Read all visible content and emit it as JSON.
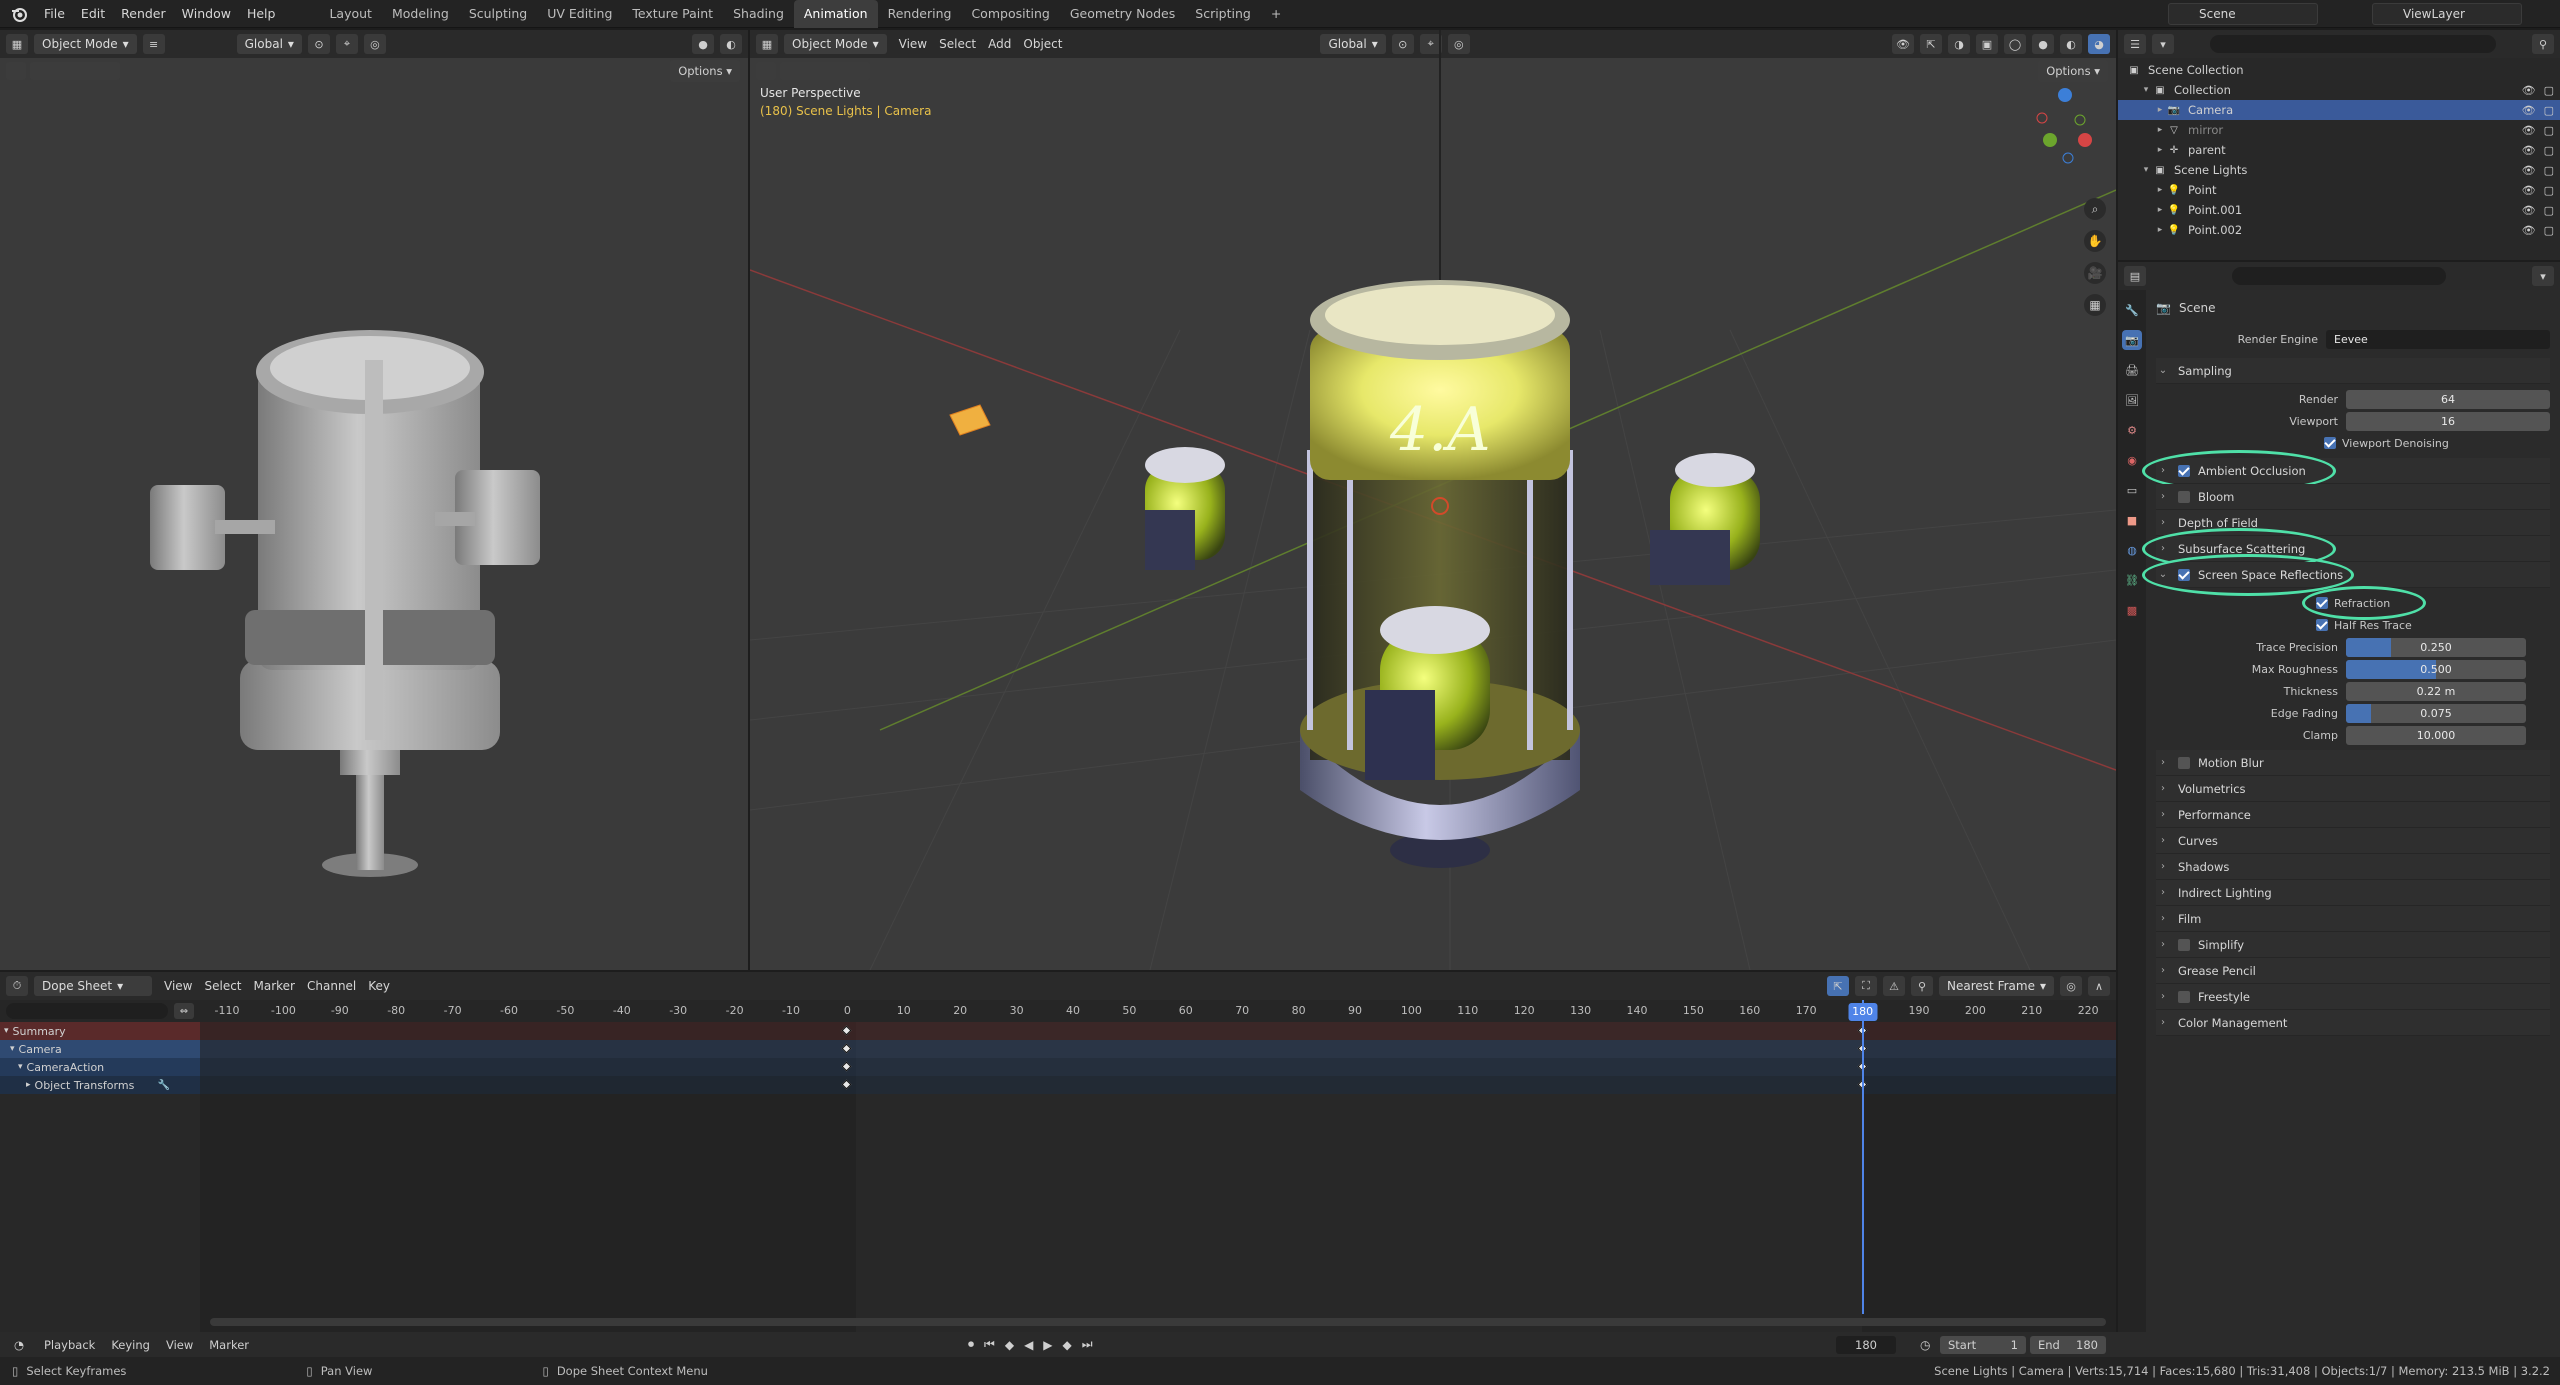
{
  "topbar": {
    "menus": [
      "File",
      "Edit",
      "Render",
      "Window",
      "Help"
    ],
    "workspaces": [
      "Layout",
      "Modeling",
      "Sculpting",
      "UV Editing",
      "Texture Paint",
      "Shading",
      "Animation",
      "Rendering",
      "Compositing",
      "Geometry Nodes",
      "Scripting"
    ],
    "active_workspace": "Animation",
    "scene": "Scene",
    "view_layer": "ViewLayer"
  },
  "left_view": {
    "mode": "Object Mode",
    "orientation": "Global",
    "options": "Options"
  },
  "main_view": {
    "mode": "Object Mode",
    "menus": [
      "View",
      "Select",
      "Add",
      "Object"
    ],
    "orientation": "Global",
    "options": "Options",
    "overlay_title": "User Perspective",
    "overlay_sub": "(180) Scene Lights | Camera",
    "logo_text": "4.A"
  },
  "outliner": {
    "root": "Scene Collection",
    "rows": [
      {
        "label": "Collection",
        "indent": 1,
        "icon": "collection",
        "open": true
      },
      {
        "label": "Camera",
        "indent": 2,
        "icon": "camera",
        "selected": true
      },
      {
        "label": "mirror",
        "indent": 2,
        "icon": "object",
        "dim": true
      },
      {
        "label": "parent",
        "indent": 2,
        "icon": "empty"
      },
      {
        "label": "Scene Lights",
        "indent": 1,
        "icon": "collection",
        "open": true
      },
      {
        "label": "Point",
        "indent": 2,
        "icon": "light"
      },
      {
        "label": "Point.001",
        "indent": 2,
        "icon": "light"
      },
      {
        "label": "Point.002",
        "indent": 2,
        "icon": "light"
      }
    ]
  },
  "properties": {
    "context": "Scene",
    "render_engine_label": "Render Engine",
    "render_engine": "Eevee",
    "sampling": {
      "title": "Sampling",
      "render_label": "Render",
      "render": "64",
      "viewport_label": "Viewport",
      "viewport": "16",
      "denoise_label": "Viewport Denoising"
    },
    "panels_top": [
      {
        "label": "Ambient Occlusion",
        "checkbox": true,
        "on": true,
        "circled": true
      },
      {
        "label": "Bloom",
        "checkbox": true,
        "on": false
      },
      {
        "label": "Depth of Field",
        "checkbox": false
      },
      {
        "label": "Subsurface Scattering",
        "checkbox": false,
        "circled": true
      }
    ],
    "ssr": {
      "title": "Screen Space Reflections",
      "refraction_label": "Refraction",
      "half_res_label": "Half Res Trace",
      "fields": [
        {
          "label": "Trace Precision",
          "value": "0.250",
          "fill": 0.25
        },
        {
          "label": "Max Roughness",
          "value": "0.500",
          "fill": 0.5
        },
        {
          "label": "Thickness",
          "value": "0.22 m",
          "fill": 0
        },
        {
          "label": "Edge Fading",
          "value": "0.075",
          "fill": 0.14
        },
        {
          "label": "Clamp",
          "value": "10.000",
          "fill": 0
        }
      ]
    },
    "panels_bottom": [
      {
        "label": "Motion Blur",
        "checkbox": true,
        "on": false
      },
      {
        "label": "Volumetrics",
        "checkbox": false
      },
      {
        "label": "Performance",
        "checkbox": false
      },
      {
        "label": "Curves",
        "checkbox": false
      },
      {
        "label": "Shadows",
        "checkbox": false
      },
      {
        "label": "Indirect Lighting",
        "checkbox": false
      },
      {
        "label": "Film",
        "checkbox": false
      },
      {
        "label": "Simplify",
        "checkbox": true,
        "on": false
      },
      {
        "label": "Grease Pencil",
        "checkbox": false
      },
      {
        "label": "Freestyle",
        "checkbox": true,
        "on": false
      },
      {
        "label": "Color Management",
        "checkbox": false
      }
    ]
  },
  "dopesheet": {
    "mode": "Dope Sheet",
    "menus": [
      "View",
      "Select",
      "Marker",
      "Channel",
      "Key"
    ],
    "snap": "Nearest Frame",
    "ticks": [
      "-110",
      "-100",
      "-90",
      "-80",
      "-70",
      "-60",
      "-50",
      "-40",
      "-30",
      "-20",
      "-10",
      "0",
      "10",
      "20",
      "30",
      "40",
      "50",
      "60",
      "70",
      "80",
      "90",
      "100",
      "110",
      "120",
      "130",
      "140",
      "150",
      "160",
      "170",
      "180",
      "190",
      "200",
      "210",
      "220"
    ],
    "current_frame": "180",
    "channels": [
      {
        "label": "Summary",
        "type": "summary"
      },
      {
        "label": "Camera",
        "type": "object"
      },
      {
        "label": "CameraAction",
        "type": "action"
      },
      {
        "label": "Object Transforms",
        "type": "group"
      }
    ]
  },
  "timeline": {
    "menus": [
      "Playback",
      "Keying",
      "View",
      "Marker"
    ],
    "frame": "180",
    "start_label": "Start",
    "start": "1",
    "end_label": "End",
    "end": "180"
  },
  "status": {
    "left1": "Select Keyframes",
    "left2": "Pan View",
    "left3": "Dope Sheet Context Menu",
    "right": "Scene Lights | Camera | Verts:15,714 | Faces:15,680 | Tris:31,408 | Objects:1/7 | Memory: 213.5 MiB | 3.2.2"
  },
  "colors": {
    "accent": "#4772b3",
    "circle": "#4fe0a8",
    "playhead": "#4f84e8",
    "overlay_sub": "#e8c14a"
  }
}
